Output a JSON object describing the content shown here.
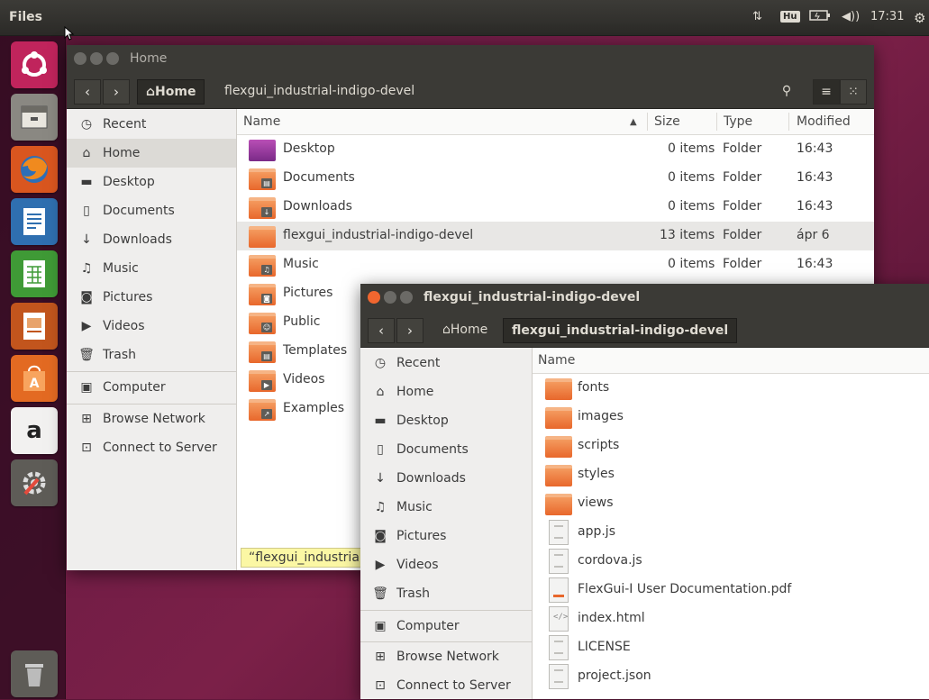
{
  "panel": {
    "app_title": "Files",
    "keyboard_layout": "Hu",
    "clock": "17:31"
  },
  "launcher": {
    "items": [
      "ubuntu-dash-icon",
      "files-icon",
      "firefox-icon",
      "writer-icon",
      "calc-icon",
      "impress-icon",
      "software-center-icon",
      "amazon-icon",
      "system-settings-icon",
      "trash-icon"
    ],
    "amazon_glyph": "a"
  },
  "home_window": {
    "title": "Home",
    "breadcrumb": {
      "home_label": "Home",
      "current_label": "flexgui_industrial-indigo-devel"
    },
    "sidebar": {
      "places": [
        "Recent",
        "Home",
        "Desktop",
        "Documents",
        "Downloads",
        "Music",
        "Pictures",
        "Videos",
        "Trash"
      ],
      "devices": [
        "Computer"
      ],
      "network": [
        "Browse Network",
        "Connect to Server"
      ]
    },
    "columns": {
      "name": "Name",
      "size": "Size",
      "type": "Type",
      "modified": "Modified"
    },
    "rows": [
      {
        "name": "Desktop",
        "size": "0 items",
        "type": "Folder",
        "modified": "16:43"
      },
      {
        "name": "Documents",
        "size": "0 items",
        "type": "Folder",
        "modified": "16:43"
      },
      {
        "name": "Downloads",
        "size": "0 items",
        "type": "Folder",
        "modified": "16:43"
      },
      {
        "name": "flexgui_industrial-indigo-devel",
        "size": "13 items",
        "type": "Folder",
        "modified": "ápr 6"
      },
      {
        "name": "Music",
        "size": "0 items",
        "type": "Folder",
        "modified": "16:43"
      },
      {
        "name": "Pictures"
      },
      {
        "name": "Public"
      },
      {
        "name": "Templates"
      },
      {
        "name": "Videos"
      },
      {
        "name": "Examples"
      }
    ],
    "status_tooltip": "“flexgui_industrial"
  },
  "project_window": {
    "title": "flexgui_industrial-indigo-devel",
    "breadcrumb": {
      "home_label": "Home",
      "current_label": "flexgui_industrial-indigo-devel"
    },
    "sidebar": {
      "places": [
        "Recent",
        "Home",
        "Desktop",
        "Documents",
        "Downloads",
        "Music",
        "Pictures",
        "Videos",
        "Trash"
      ],
      "devices": [
        "Computer"
      ],
      "network": [
        "Browse Network",
        "Connect to Server"
      ]
    },
    "columns": {
      "name": "Name"
    },
    "rows": [
      {
        "name": "fonts",
        "kind": "folder"
      },
      {
        "name": "images",
        "kind": "folder"
      },
      {
        "name": "scripts",
        "kind": "folder"
      },
      {
        "name": "styles",
        "kind": "folder"
      },
      {
        "name": "views",
        "kind": "folder"
      },
      {
        "name": "app.js",
        "kind": "text"
      },
      {
        "name": "cordova.js",
        "kind": "text"
      },
      {
        "name": "FlexGui-I User Documentation.pdf",
        "kind": "pdf"
      },
      {
        "name": "index.html",
        "kind": "html"
      },
      {
        "name": "LICENSE",
        "kind": "text"
      },
      {
        "name": "project.json",
        "kind": "text"
      }
    ]
  },
  "colors": {
    "accent": "#e8672b",
    "close_button": "#f0662f",
    "titlebar": "#3b3a36"
  }
}
